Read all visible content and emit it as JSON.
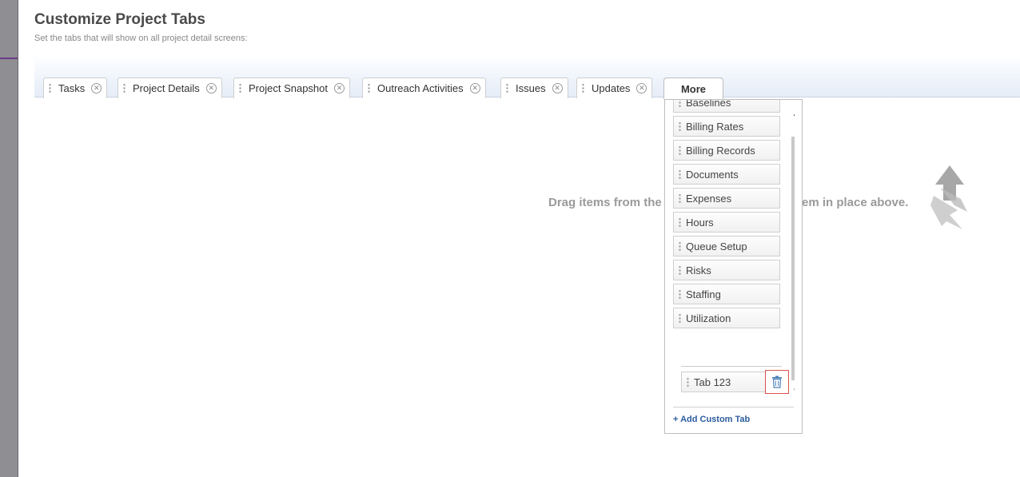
{
  "header": {
    "title": "Customize Project Tabs",
    "subtitle": "Set the tabs that will show on all project detail screens:"
  },
  "tabs": [
    {
      "label": "Tasks"
    },
    {
      "label": "Project Details"
    },
    {
      "label": "Project Snapshot"
    },
    {
      "label": "Outreach Activities"
    },
    {
      "label": "Issues"
    },
    {
      "label": "Updates"
    }
  ],
  "more_tab": {
    "label": "More"
  },
  "drag_hint": {
    "text_left": "Drag items from the",
    "text_right": "em in place above."
  },
  "available_tabs": [
    {
      "label": "Baselines"
    },
    {
      "label": "Billing Rates"
    },
    {
      "label": "Billing Records"
    },
    {
      "label": "Documents"
    },
    {
      "label": "Expenses"
    },
    {
      "label": "Hours"
    },
    {
      "label": "Queue Setup"
    },
    {
      "label": "Risks"
    },
    {
      "label": "Staffing"
    },
    {
      "label": "Utilization"
    }
  ],
  "custom_tabs": [
    {
      "label": "Tab 123"
    }
  ],
  "add_custom": {
    "label": "+ Add Custom Tab"
  },
  "icons": {
    "close": "close-circle-icon",
    "trash": "trash-icon",
    "grip": "drag-handle-icon",
    "arrow": "drag-arrow-icon"
  },
  "colors": {
    "accent_link": "#2b5b9e",
    "delete_highlight": "#d9534f",
    "sidebar_strip": "#8e8e93"
  }
}
